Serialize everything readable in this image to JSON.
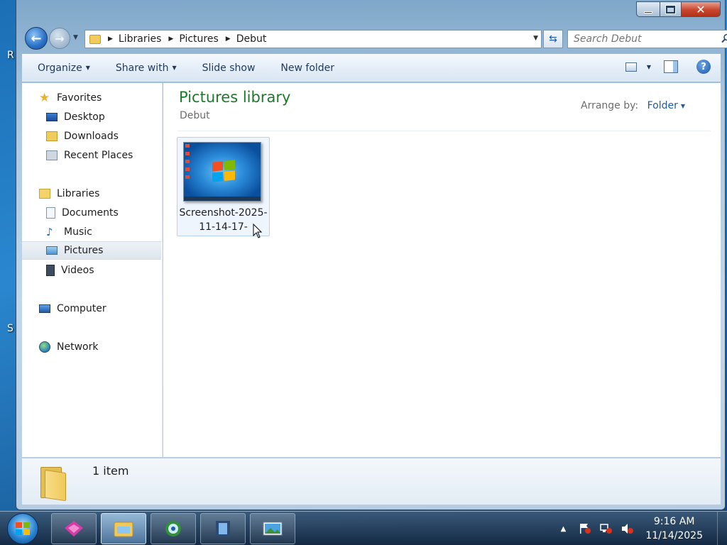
{
  "window": {
    "title": "Debut",
    "min_label": "",
    "max_label": "",
    "close_label": "✕"
  },
  "address": {
    "breadcrumbs": [
      "Libraries",
      "Pictures",
      "Debut"
    ]
  },
  "search": {
    "placeholder": "Search Debut"
  },
  "commands": {
    "organize": "Organize",
    "share_with": "Share with",
    "slide_show": "Slide show",
    "new_folder": "New folder"
  },
  "nav": {
    "favorites": "Favorites",
    "desktop": "Desktop",
    "downloads": "Downloads",
    "recent_places": "Recent Places",
    "libraries": "Libraries",
    "documents": "Documents",
    "music": "Music",
    "pictures": "Pictures",
    "videos": "Videos",
    "computer": "Computer",
    "network": "Network",
    "selected": "Pictures"
  },
  "content": {
    "library_title": "Pictures library",
    "subtitle": "Debut",
    "arrange_label": "Arrange by:",
    "arrange_value": "Folder",
    "files": [
      {
        "name_line1": "Screenshot-2025-",
        "name_line2": "11-14-17-"
      }
    ]
  },
  "status": {
    "count": "1 item"
  },
  "taskbar": {
    "time": "9:16 AM",
    "date": "11/14/2025"
  },
  "colors": {
    "library_title": "#1d7a2a",
    "link_blue": "#1f5ca8",
    "close_button": "#c9462d"
  },
  "icons": {
    "nav": [
      "star-icon",
      "desktop-icon",
      "downloads-folder-icon",
      "recent-places-icon",
      "libraries-icon",
      "documents-icon",
      "music-icon",
      "pictures-icon",
      "videos-icon",
      "computer-icon",
      "network-icon"
    ],
    "taskbar": [
      "start-orb-icon",
      "app-pink-icon",
      "explorer-icon",
      "media-center-icon",
      "video-editor-icon",
      "photo-gallery-icon"
    ]
  }
}
